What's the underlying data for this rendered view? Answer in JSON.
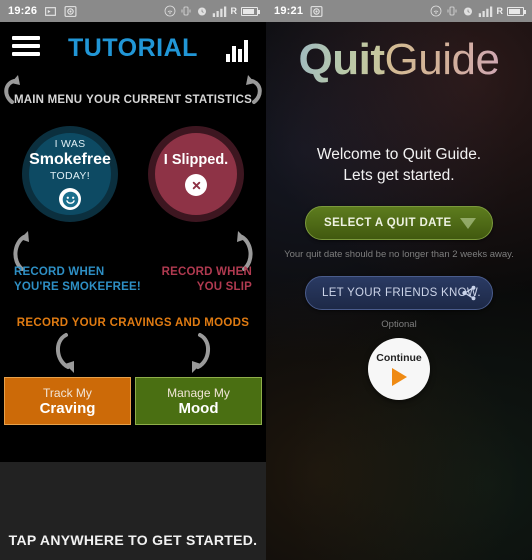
{
  "left_phone": {
    "status_bar": {
      "time": "19:26",
      "icons": [
        "screen-cast-icon",
        "record-icon",
        "hotspot-icon",
        "vibrate-icon",
        "alarm-icon",
        "signal-icon",
        "roaming-indicator",
        "battery-icon"
      ],
      "roaming_label": "R"
    },
    "header": {
      "menu_icon": "hamburger-menu-icon",
      "title": "TUTORIAL",
      "stats_icon": "bar-chart-icon"
    },
    "callouts": {
      "main_menu": "MAIN MENU",
      "statistics": "YOUR CURRENT STATISTICS"
    },
    "smokefree_circle": {
      "line1": "I WAS",
      "line2": "Smokefree",
      "line3": "TODAY!",
      "badge_icon": "smiley-face-icon",
      "badge_glyph": "☺",
      "color": "#0d4a63",
      "ring_color": "#0b2f3e"
    },
    "slipped_circle": {
      "line1": "I Slipped.",
      "badge_icon": "x-mark-icon",
      "badge_glyph": "✕",
      "color": "#8e3346",
      "ring_color": "#3d1620"
    },
    "captions": {
      "smokefree": "RECORD WHEN\nYOU'RE SMOKEFREE!",
      "smokefree_l1": "RECORD WHEN",
      "smokefree_l2": "YOU'RE SMOKEFREE!",
      "smokefree_color": "#2e8fc4",
      "slip_l1": "RECORD WHEN",
      "slip_l2": "YOU SLIP",
      "slip_color": "#b03a50",
      "cravings": "RECORD YOUR CRAVINGS AND MOODS",
      "cravings_color": "#e07b12"
    },
    "buttons": [
      {
        "top": "Track My",
        "bottom": "Craving",
        "color": "#cc6a08"
      },
      {
        "top": "Manage My",
        "bottom": "Mood",
        "color": "#4a6f12"
      }
    ],
    "footer": "TAP ANYWHERE TO GET STARTED."
  },
  "right_phone": {
    "status_bar": {
      "time": "19:21",
      "roaming_label": "R"
    },
    "logo": {
      "part1": "Quit",
      "part2": "Guide"
    },
    "welcome_line1": "Welcome to Quit Guide.",
    "welcome_line2": "Lets get started.",
    "quit_date_button": {
      "label": "SELECT A QUIT DATE",
      "dropdown_icon": "chevron-down-icon",
      "color": "#5d7c1e"
    },
    "quit_date_hint": "Your quit date should be no longer than 2 weeks away.",
    "friends_button": {
      "label": "LET YOUR FRIENDS KNOW.",
      "share_icon": "share-icon",
      "color": "#2a3a63"
    },
    "friends_hint": "Optional",
    "continue_button": {
      "label": "Continue",
      "play_icon": "play-triangle-icon",
      "accent": "#ef8a13"
    }
  }
}
